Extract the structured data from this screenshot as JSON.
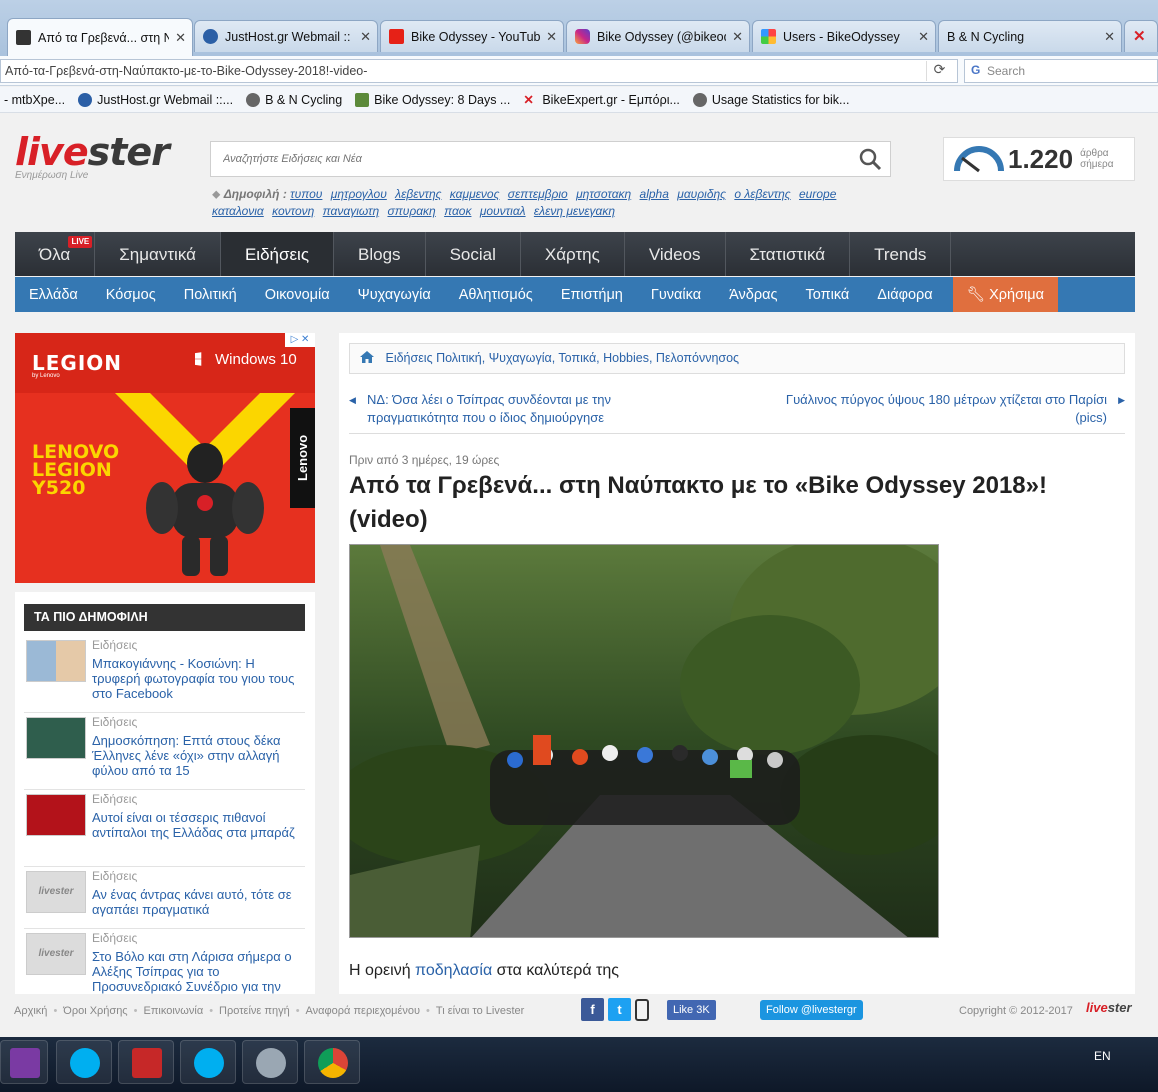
{
  "browser": {
    "tabs": [
      {
        "title": "Από τα Γρεβενά... στη Ναύπακτο",
        "active": true
      },
      {
        "title": "JustHost.gr Webmail :: Επ"
      },
      {
        "title": "Bike Odyssey - YouTube"
      },
      {
        "title": "Bike Odyssey (@bikeodysse"
      },
      {
        "title": "Users - BikeOdyssey"
      },
      {
        "title": "B & N Cycling"
      },
      {
        "title": ""
      }
    ],
    "url": "Από-τα-Γρεβενά-στη-Ναύπακτο-με-το-Bike-Odyssey-2018!-video-",
    "search_placeholder": "Search",
    "bookmarks": [
      "- mtbXpe...",
      "JustHost.gr Webmail ::...",
      "B & N Cycling",
      "Bike Odyssey: 8 Days ...",
      "BikeExpert.gr - Εμπόρι...",
      "Usage Statistics for bik..."
    ]
  },
  "header": {
    "logo_a": "live",
    "logo_b": "ster",
    "logo_tagline": "Ενημέρωση Live",
    "search_placeholder": "Αναζητήστε Ειδήσεις και Νέα",
    "popular_label": "Δημοφιλή :",
    "popular_tags": [
      "τυπου",
      "μητρογλου",
      "λεβεντης",
      "καμμενος",
      "σεπτεμβριο",
      "μητσοτακη",
      "alpha",
      "μαυριδης",
      "ο λεβεντης",
      "europe",
      "καταλονια",
      "κοντονη",
      "παναγιωτη",
      "σπυρακη",
      "παοκ",
      "μουντιαλ",
      "ελενη μενεγακη"
    ],
    "counter_value": "1.220",
    "counter_unit_1": "άρθρα",
    "counter_unit_2": "σήμερα"
  },
  "main_nav": {
    "items": [
      "Όλα",
      "Σημαντικά",
      "Ειδήσεις",
      "Blogs",
      "Social",
      "Χάρτης",
      "Videos",
      "Στατιστικά",
      "Trends"
    ],
    "selected": "Ειδήσεις",
    "live_badge": "LIVE"
  },
  "sub_nav": {
    "items": [
      "Ελλάδα",
      "Κόσμος",
      "Πολιτική",
      "Οικονομία",
      "Ψυχαγωγία",
      "Αθλητισμός",
      "Επιστήμη",
      "Γυναίκα",
      "Άνδρας",
      "Τοπικά",
      "Διάφορα"
    ],
    "tools": "Χρήσιμα"
  },
  "ad": {
    "brand": "LEGION",
    "by": "by Lenovo",
    "windows": "Windows 10",
    "product_1": "LENOVO",
    "product_2": "LEGION",
    "product_3": "Y520",
    "side": "Lenovo"
  },
  "popular_box": {
    "heading": "ΤΑ ΠΙΟ ΔΗΜΟΦΙΛΗ",
    "items": [
      {
        "category": "Ειδήσεις",
        "title": "Μπακογιάννης - Κοσιώνη: Η τρυφερή φωτογραφία του γιου τους στο Facebook"
      },
      {
        "category": "Ειδήσεις",
        "title": "Δημοσκόπηση: Επτά στους δέκα Έλληνες λένε «όχι» στην αλλαγή φύλου από τα 15"
      },
      {
        "category": "Ειδήσεις",
        "title": "Αυτοί είναι οι τέσσερις πιθανοί αντίπαλοι της Ελλάδας στα μπαράζ"
      },
      {
        "category": "Ειδήσεις",
        "title": "Αν ένας άντρας κάνει αυτό, τότε σε αγαπάει πραγματικά"
      },
      {
        "category": "Ειδήσεις",
        "title": "Στο Βόλο και στη Λάρισα σήμερα ο Αλέξης Τσίπρας για το Προσυνεδριακό Συνέδριο για την"
      }
    ],
    "thumb_logo": "livester"
  },
  "article": {
    "breadcrumb": "Ειδήσεις   Πολιτική, Ψυχαγωγία, Τοπικά, Hobbies, Πελοπόννησος",
    "prev": "ΝΔ: Όσα λέει ο Τσίπρας συνδέονται με την πραγματικότητα που ο ίδιος δημιούργησε",
    "next": "Γυάλινος πύργος ύψους 180 μέτρων χτίζεται στο Παρίσι (pics)",
    "time_ago": "Πριν από 3 ημέρες, 19 ώρες",
    "title": "Από τα Γρεβενά... στη Ναύπακτο με το «Bike Odyssey 2018»! (video)",
    "lead_before": "Η ορεινή ",
    "lead_link": "ποδηλασία",
    "lead_after": " στα καλύτερά της"
  },
  "footer": {
    "links": [
      "Αρχική",
      "Όροι Χρήσης",
      "Επικοινωνία",
      "Προτείνε πηγή",
      "Αναφορά περιεχομένου",
      "Τι είναι το Livester"
    ],
    "like": "Like 3K",
    "follow": "Follow @livestergr",
    "copyright": "Copyright © 2012-2017"
  },
  "taskbar": {
    "lang": "EN"
  }
}
